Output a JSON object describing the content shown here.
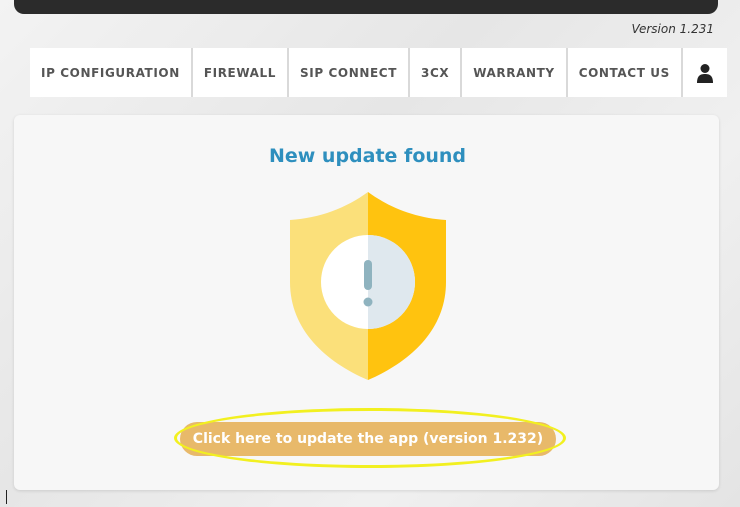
{
  "header": {
    "version_label": "Version 1.231"
  },
  "nav": {
    "items": [
      {
        "label": "IP CONFIGURATION"
      },
      {
        "label": "FIREWALL"
      },
      {
        "label": "SIP CONNECT"
      },
      {
        "label": "3CX"
      },
      {
        "label": "WARRANTY"
      },
      {
        "label": "CONTACT US"
      }
    ],
    "user_icon": "user-icon"
  },
  "update_card": {
    "title": "New update found",
    "icon": "shield-warning-icon",
    "button_label": "Click here to update the app (version 1.232)"
  },
  "colors": {
    "title": "#2e8fbe",
    "shield_light": "#fbe07a",
    "shield_dark": "#ffc30f",
    "button": "#e8b96a",
    "highlight": "#f2f020"
  }
}
